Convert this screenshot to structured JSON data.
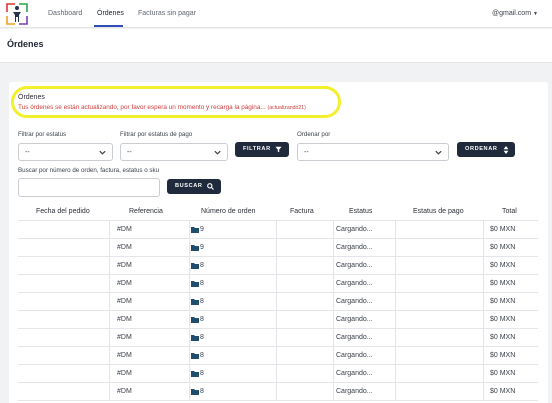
{
  "nav": {
    "items": [
      {
        "label": "Dashboard"
      },
      {
        "label": "Órdenes"
      },
      {
        "label": "Facturas sin pagar"
      }
    ],
    "active_index": 1,
    "user_email": "@gmail.com"
  },
  "page": {
    "title": "Órdenes"
  },
  "notice": {
    "title": "Órdenes",
    "message": "Tus órdenes se están actualizando, por favor espera un momento y recarga la página...",
    "updating_label": "(actualizando21)"
  },
  "filters": {
    "status_label": "Filtrar por estatus",
    "status_value": "--",
    "payment_label": "Filtrar por estatus de pago",
    "payment_value": "--",
    "filter_button": "FILTRAR",
    "order_label": "Ordenar por",
    "order_value": "--",
    "order_button": "ORDENAR",
    "search_label": "Buscar por número de orden, factura, estatus o sku",
    "search_value": "",
    "search_button": "BUSCAR"
  },
  "table": {
    "columns": [
      "Fecha del pedido",
      "Referencia",
      "Número de orden",
      "Factura",
      "Estatus",
      "Estatus de pago",
      "Total"
    ],
    "rows": [
      {
        "fecha": "",
        "referencia": "#DM",
        "numero": "9",
        "factura": "",
        "estatus": "Cargando...",
        "pago": "",
        "total": "$0 MXN"
      },
      {
        "fecha": "",
        "referencia": "#DM",
        "numero": "9",
        "factura": "",
        "estatus": "Cargando...",
        "pago": "",
        "total": "$0 MXN"
      },
      {
        "fecha": "",
        "referencia": "#DM",
        "numero": "8",
        "factura": "",
        "estatus": "Cargando...",
        "pago": "",
        "total": "$0 MXN"
      },
      {
        "fecha": "",
        "referencia": "#DM",
        "numero": "8",
        "factura": "",
        "estatus": "Cargando...",
        "pago": "",
        "total": "$0 MXN"
      },
      {
        "fecha": "",
        "referencia": "#DM",
        "numero": "8",
        "factura": "",
        "estatus": "Cargando...",
        "pago": "",
        "total": "$0 MXN"
      },
      {
        "fecha": "",
        "referencia": "#DM",
        "numero": "8",
        "factura": "",
        "estatus": "Cargando...",
        "pago": "",
        "total": "$0 MXN"
      },
      {
        "fecha": "",
        "referencia": "#DM",
        "numero": "8",
        "factura": "",
        "estatus": "Cargando...",
        "pago": "",
        "total": "$0 MXN"
      },
      {
        "fecha": "",
        "referencia": "#DM",
        "numero": "8",
        "factura": "",
        "estatus": "Cargando...",
        "pago": "",
        "total": "$0 MXN"
      },
      {
        "fecha": "",
        "referencia": "#DM",
        "numero": "8",
        "factura": "",
        "estatus": "Cargando...",
        "pago": "",
        "total": "$0 MXN"
      },
      {
        "fecha": "",
        "referencia": "#DM",
        "numero": "8",
        "factura": "",
        "estatus": "Cargando...",
        "pago": "",
        "total": "$0 MXN"
      }
    ]
  },
  "colors": {
    "accent": "#2f4fb7",
    "button": "#1f2a3d",
    "error_text": "#d23b3b",
    "highlight": "#f2ef2c",
    "folder": "#1f4e6e"
  },
  "icons": [
    "logo",
    "chevron-down-icon",
    "filter-icon",
    "sort-icon",
    "search-icon",
    "folder-icon"
  ]
}
